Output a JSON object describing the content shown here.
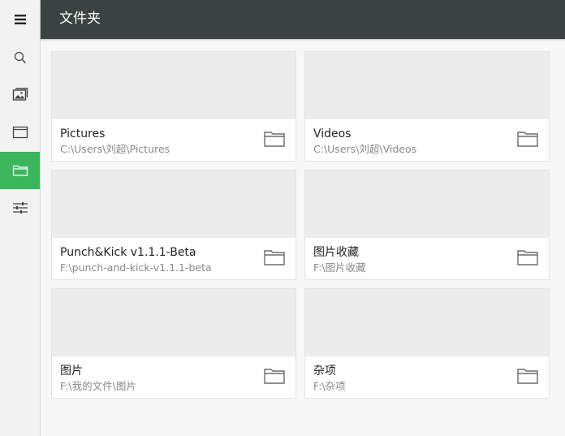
{
  "header": {
    "title": "文件夹"
  },
  "sidebar": {
    "items": [
      {
        "name": "menu",
        "icon": "hamburger-menu-icon",
        "active": false
      },
      {
        "name": "search",
        "icon": "search-icon",
        "active": false
      },
      {
        "name": "photos",
        "icon": "image-gallery-icon",
        "active": false
      },
      {
        "name": "albums",
        "icon": "album-window-icon",
        "active": false
      },
      {
        "name": "folders",
        "icon": "folder-icon",
        "active": true
      },
      {
        "name": "settings",
        "icon": "sliders-icon",
        "active": false
      }
    ]
  },
  "folders": [
    {
      "name": "Pictures",
      "path": "C:\\Users\\刘超\\Pictures",
      "icon": "folder-icon"
    },
    {
      "name": "Videos",
      "path": "C:\\Users\\刘超\\Videos",
      "icon": "folder-icon"
    },
    {
      "name": "Punch&Kick  v1.1.1-Beta",
      "path": "F:\\punch-and-kick-v1.1.1-beta",
      "icon": "folder-icon"
    },
    {
      "name": "图片收藏",
      "path": "F:\\图片收藏",
      "icon": "folder-icon"
    },
    {
      "name": "图片",
      "path": "F:\\我的文件\\图片",
      "icon": "folder-icon"
    },
    {
      "name": "杂项",
      "path": "F:\\杂项",
      "icon": "folder-icon"
    }
  ],
  "colors": {
    "accent": "#3cb65c",
    "header_bg": "#3b4241"
  }
}
